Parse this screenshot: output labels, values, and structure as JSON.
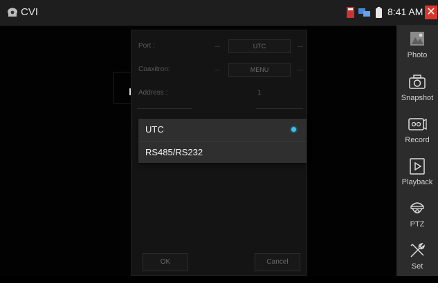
{
  "app": {
    "title": "CVI"
  },
  "statusbar": {
    "time": "8:41 AM"
  },
  "sidebar": {
    "items": [
      {
        "label": "Photo",
        "icon": "photo-icon"
      },
      {
        "label": "Snapshot",
        "icon": "camera-icon"
      },
      {
        "label": "Record",
        "icon": "record-icon"
      },
      {
        "label": "Playback",
        "icon": "playback-icon"
      },
      {
        "label": "PTZ",
        "icon": "ptz-camera-icon"
      },
      {
        "label": "Set",
        "icon": "wrench-icon"
      }
    ]
  },
  "panel": {
    "rows": [
      {
        "label": "Port :",
        "value": "UTC"
      },
      {
        "label": "Coaxitron:",
        "value": "MENU"
      },
      {
        "label": "Address :",
        "value": "1"
      }
    ],
    "ok_label": "OK",
    "cancel_label": "Cancel"
  },
  "popup": {
    "options": [
      {
        "label": "UTC",
        "selected": true
      },
      {
        "label": "RS485/RS232",
        "selected": false
      }
    ]
  },
  "colors": {
    "accent": "#37c2ee",
    "close": "#d8352c",
    "sidebar": "#2c2c2c"
  }
}
